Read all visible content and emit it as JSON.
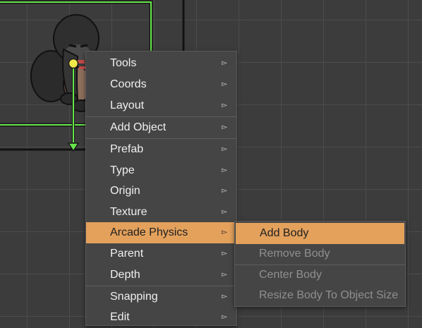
{
  "context_menu": {
    "items": [
      {
        "label": "Tools",
        "arrow": "▻"
      },
      {
        "label": "Coords",
        "arrow": "▻"
      },
      {
        "label": "Layout",
        "arrow": "▻"
      },
      {
        "label": "Add Object",
        "arrow": "▻"
      },
      {
        "label": "Prefab",
        "arrow": "▻"
      },
      {
        "label": "Type",
        "arrow": "▻"
      },
      {
        "label": "Origin",
        "arrow": "▻"
      },
      {
        "label": "Texture",
        "arrow": "▻"
      },
      {
        "label": "Arcade Physics",
        "arrow": "▻"
      },
      {
        "label": "Parent",
        "arrow": "▻"
      },
      {
        "label": "Depth",
        "arrow": "▻"
      },
      {
        "label": "Snapping",
        "arrow": "▻"
      },
      {
        "label": "Edit",
        "arrow": "▻"
      }
    ]
  },
  "submenu": {
    "items": [
      {
        "label": "Add Body"
      },
      {
        "label": "Remove Body"
      },
      {
        "label": "Center Body"
      },
      {
        "label": "Resize Body To Object Size"
      }
    ]
  },
  "colors": {
    "highlight": "#e3a15c",
    "selection_outline": "#66e64a",
    "origin_handle": "#f2e84a",
    "canvas_bg": "#3c3c3c",
    "menu_bg": "#454545"
  },
  "icons": {
    "arrow": "triangle-right-icon",
    "origin_handle": "origin-handle-icon",
    "y_axis_arrow": "arrow-down-icon"
  }
}
